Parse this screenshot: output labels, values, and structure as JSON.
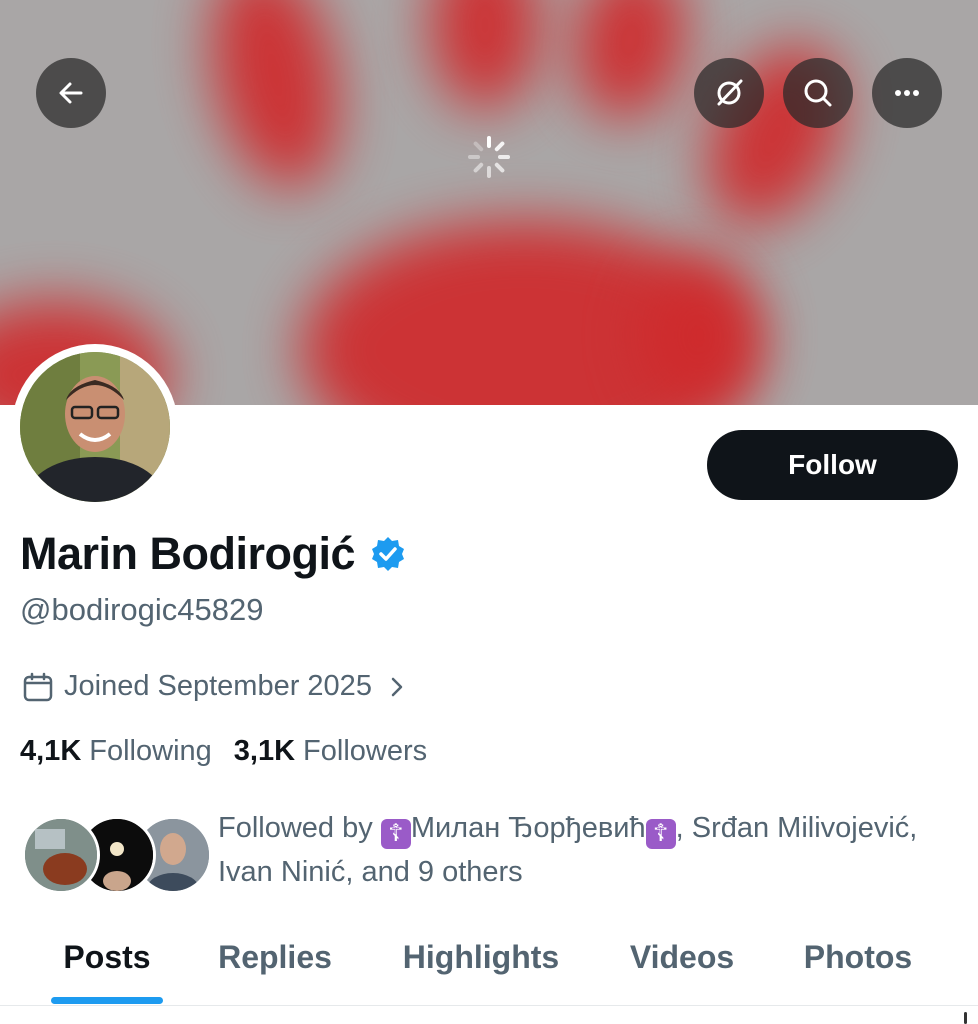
{
  "header": {
    "back_icon": "arrow-left-icon",
    "grok_icon": "grok-icon",
    "search_icon": "search-icon",
    "more_icon": "more-horizontal-icon",
    "loading_icon": "spinner-icon"
  },
  "profile": {
    "name": "Marin Bodirogić",
    "verified": true,
    "verified_color": "#1d9bf0",
    "handle": "@bodirogic45829",
    "joined": "Joined September 2025",
    "follow_label": "Follow"
  },
  "stats": {
    "following_count": "4,1K",
    "following_label": "Following",
    "followers_count": "3,1K",
    "followers_label": "Followers"
  },
  "followed_by": {
    "prefix": "Followed by ",
    "emoji": "☦",
    "name1": "Милан Ђорђевић",
    "rest": ", Srđan Milivojević, Ivan Ninić, and 9 others"
  },
  "tabs": [
    {
      "label": "Posts",
      "active": true
    },
    {
      "label": "Replies",
      "active": false
    },
    {
      "label": "Highlights",
      "active": false
    },
    {
      "label": "Videos",
      "active": false
    },
    {
      "label": "Photos",
      "active": false
    }
  ],
  "colors": {
    "accent": "#1d9bf0",
    "text_primary": "#0f1419",
    "text_secondary": "#536471",
    "banner_red": "#cf2a2c"
  }
}
